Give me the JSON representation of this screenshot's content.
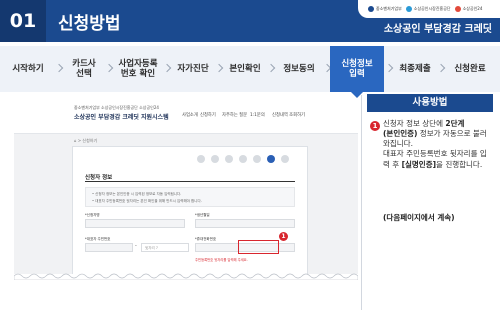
{
  "header": {
    "number": "01",
    "title": "신청방법",
    "brand": "소상공인 부담경감 크레딧",
    "logos": [
      "중소벤처기업부",
      "소상공인시장진흥공단",
      "소상공인24"
    ]
  },
  "steps": [
    {
      "label": "시작하기",
      "active": false
    },
    {
      "label": "카드사\n선택",
      "active": false
    },
    {
      "label": "사업자등록\n번호 확인",
      "active": false
    },
    {
      "label": "자가진단",
      "active": false
    },
    {
      "label": "본인확인",
      "active": false
    },
    {
      "label": "정보동의",
      "active": false
    },
    {
      "label": "신청정보\n입력",
      "active": true
    },
    {
      "label": "최종제출",
      "active": false
    },
    {
      "label": "신청완료",
      "active": false
    }
  ],
  "screenshot": {
    "logos": "중소벤처기업부  소상공인시장진흥공단  소상공인24",
    "site_title": "소상공인 부담경감 크레딧 지원시스템",
    "nav": [
      "사업소개",
      "신청하기",
      "자주하는 질문",
      "1:1문의",
      "신청내역 조회하기"
    ],
    "breadcrumb": "⌂ > 신청하기",
    "form_title": "신청자 정보",
    "notices": [
      "• 신청자 정보는 본인인증 시 입력된 정보로 자동 입력됩니다.",
      "• 대표자 주민등록번호 뒷자리는 본인 확인을 위해 반드시 입력해야 합니다."
    ],
    "fields": {
      "name_label": "*신청자명",
      "birth_label": "*생년월일",
      "ssn_label": "*대표자 주민번호",
      "phone_label": "*휴대전화번호",
      "ssn_placeholder": "뒷자리 7",
      "warning": "주민등록번호 뒷자리를 입력해 주세요.",
      "marker": "1"
    }
  },
  "usage": {
    "title": "사용방법",
    "marker": "1",
    "lines": [
      {
        "text": "신청자 정보 상단에 ",
        "bold": "2단계"
      },
      {
        "text": "",
        "bold": "(본인인증)"
      },
      {
        "text": " 정보가 자동으로 불러와집니다.",
        "bold": ""
      },
      {
        "text": "대표자 주민등록번호 뒷자리를 입력 후 ",
        "bold": "[실명인증]"
      },
      {
        "text": "을 진행합니다.",
        "bold": ""
      }
    ],
    "next": "(다음페이지에서 계속)"
  },
  "colors": {
    "primary": "#1b4a8f",
    "active_step": "#2a67c0",
    "highlight": "#d8262e"
  }
}
